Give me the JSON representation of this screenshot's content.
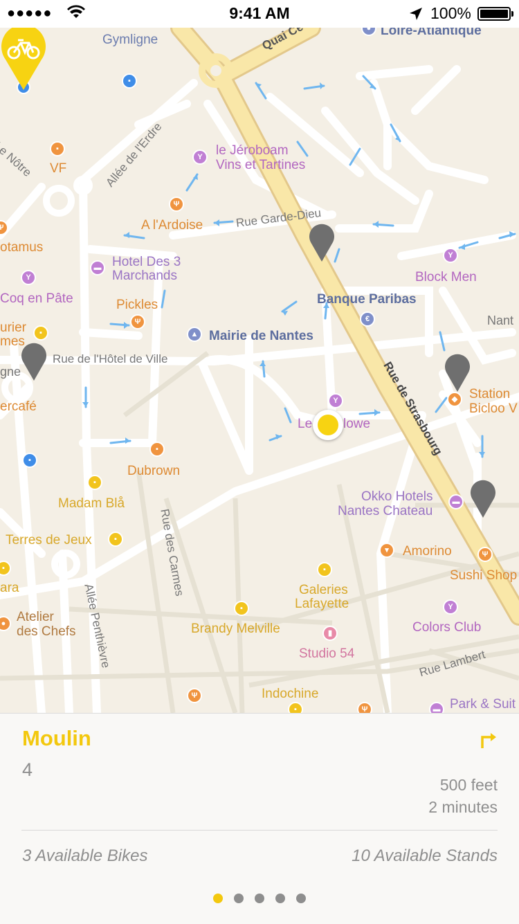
{
  "status_bar": {
    "carrier": "●●●●●",
    "time": "9:41 AM",
    "battery": "100%"
  },
  "map": {
    "places": [
      {
        "name": "Gymligne"
      },
      {
        "name": "Loire-Atlantique"
      },
      {
        "name": "VF"
      },
      {
        "name": "le Jéroboam"
      },
      {
        "name": "Vins et Tartines"
      },
      {
        "name": "A l'Ardoise"
      },
      {
        "name": "otamus"
      },
      {
        "name": "Hotel Des 3"
      },
      {
        "name": "Marchands"
      },
      {
        "name": "Coq en Pâte"
      },
      {
        "name": "Pickles"
      },
      {
        "name": "Block Men"
      },
      {
        "name": "Banque Paribas"
      },
      {
        "name": "Mairie de Nantes"
      },
      {
        "name": "Nant"
      },
      {
        "name": "urier"
      },
      {
        "name": "mes"
      },
      {
        "name": "gne"
      },
      {
        "name": "ercafé"
      },
      {
        "name": "Station"
      },
      {
        "name": "Bicloo V"
      },
      {
        "name": "Le"
      },
      {
        "name": "lowe"
      },
      {
        "name": "Dubrown"
      },
      {
        "name": "Madam Blå"
      },
      {
        "name": "Okko Hotels"
      },
      {
        "name": "Nantes Chateau"
      },
      {
        "name": "Terres de Jeux"
      },
      {
        "name": "Amorino"
      },
      {
        "name": "Sushi Shop"
      },
      {
        "name": "ara"
      },
      {
        "name": "Galeries"
      },
      {
        "name": "Lafayette"
      },
      {
        "name": "Atelier"
      },
      {
        "name": "des Chefs"
      },
      {
        "name": "Brandy Melville"
      },
      {
        "name": "Colors Club"
      },
      {
        "name": "Studio 54"
      },
      {
        "name": "Indochine"
      },
      {
        "name": "Park & Suit"
      }
    ],
    "streets": [
      {
        "name": "Quai Ce"
      },
      {
        "name": "Allée de l'Erdre"
      },
      {
        "name": "Le Nôtre"
      },
      {
        "name": "Rue Garde-Dieu"
      },
      {
        "name": "Rue de l'Hôtel de Ville"
      },
      {
        "name": "Rue de Strasbourg"
      },
      {
        "name": "Rue des Carmes"
      },
      {
        "name": "Allée Penthièvre"
      },
      {
        "name": "Rue Lambert"
      }
    ]
  },
  "station": {
    "name": "Moulin",
    "number": "4",
    "distance": "500 feet",
    "duration": "2 minutes",
    "available_bikes": "3 Available Bikes",
    "available_stands": "10 Available Stands"
  },
  "pager": {
    "pages": 5,
    "current": 1
  },
  "colors": {
    "accent": "#f3c80e",
    "pin_gray": "#6f6f6f",
    "road_major": "#f7e6a6",
    "route_arrow": "#6fb6ef"
  }
}
